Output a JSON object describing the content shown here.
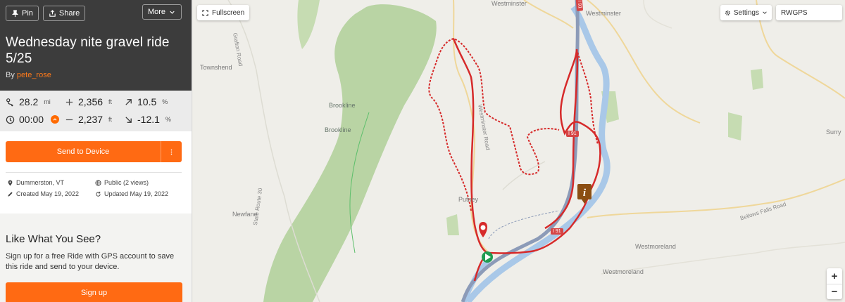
{
  "header": {
    "pin_label": "Pin",
    "share_label": "Share",
    "more_label": "More",
    "title": "Wednesday nite gravel ride 5/25",
    "by_label": "By",
    "author": "pete_rose"
  },
  "stats": {
    "distance": {
      "value": "28.2",
      "unit": "mi"
    },
    "elevation_gain": {
      "value": "2,356",
      "unit": "ft"
    },
    "max_grade": {
      "value": "10.5",
      "unit": "%"
    },
    "duration": {
      "value": "00:00"
    },
    "elevation_loss": {
      "value": "2,237",
      "unit": "ft"
    },
    "min_grade": {
      "value": "-12.1",
      "unit": "%"
    }
  },
  "actions": {
    "send_label": "Send to Device"
  },
  "meta": {
    "location": "Dummerston, VT",
    "visibility": "Public (2 views)",
    "created": "Created May 19, 2022",
    "updated": "Updated May 19, 2022"
  },
  "promo": {
    "title": "Like What You See?",
    "text": "Sign up for a free Ride with GPS account to save this ride and send to your device.",
    "signup_label": "Sign up"
  },
  "map": {
    "fullscreen_label": "Fullscreen",
    "settings_label": "Settings",
    "basemap": "RWGPS",
    "zoom_in": "+",
    "zoom_out": "−",
    "labels": {
      "westminster_top": "Westminster",
      "westminster": "Westminster",
      "townshend": "Townshend",
      "brookline_1": "Brookline",
      "brookline_2": "Brookline",
      "putney": "Putney",
      "newfane": "Newfane",
      "westmoreland_1": "Westmoreland",
      "westmoreland_2": "Westmoreland",
      "surry": "Surry",
      "grafton_road": "Grafton Road",
      "westminster_road": "Westminster Road",
      "state_route_30": "State Route 30",
      "bellows_falls_road": "Bellows Falls Road",
      "i91_a": "I 91",
      "i91_b": "I 91",
      "i91_c": "I 91"
    },
    "colors": {
      "route": "#d62a2a",
      "forest": "#b9d4a4",
      "water": "#a9c8e8",
      "highway": "#8c9bb8",
      "accent": "#ff6a13"
    }
  }
}
